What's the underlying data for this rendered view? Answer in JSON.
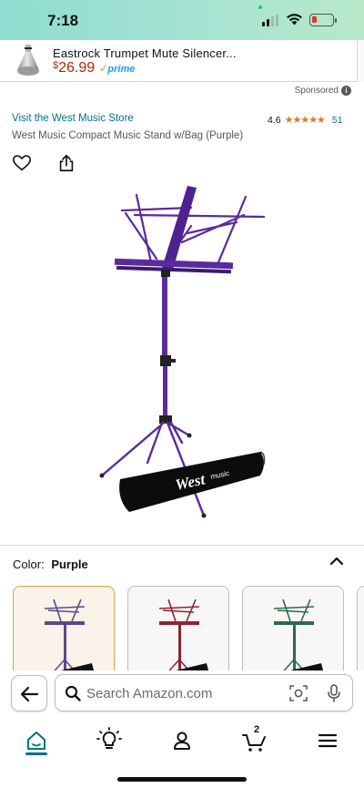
{
  "status_bar": {
    "time": "7:18"
  },
  "sponsored_ad": {
    "title": "Eastrock Trumpet Mute Silencer...",
    "currency": "$",
    "price": "26.99",
    "prime_label": "prime",
    "sponsored_label": "Sponsored",
    "info_icon_glyph": "i"
  },
  "product": {
    "store_link": "Visit the West Music Store",
    "rating_value": "4.6",
    "stars": "★★★★★",
    "stars_value": 4.6,
    "rating_count": "51",
    "title": "West Music Compact Music Stand w/Bag (Purple)",
    "bag_brand": "West",
    "bag_brand_suffix": "music"
  },
  "color_selector": {
    "label": "Color:",
    "selected": "Purple",
    "swatch_colors": [
      "#5a4a8a",
      "#8b2530",
      "#2e6b4a"
    ]
  },
  "search": {
    "placeholder": "Search Amazon.com"
  },
  "bottom_nav": {
    "items": [
      "home-icon",
      "bulb-icon",
      "account-icon",
      "cart-icon",
      "menu-icon"
    ],
    "cart_count": "2"
  },
  "colors": {
    "link": "#007185",
    "price": "#b12704",
    "star": "#de7921",
    "stand_purple": "#5b2a9e"
  }
}
